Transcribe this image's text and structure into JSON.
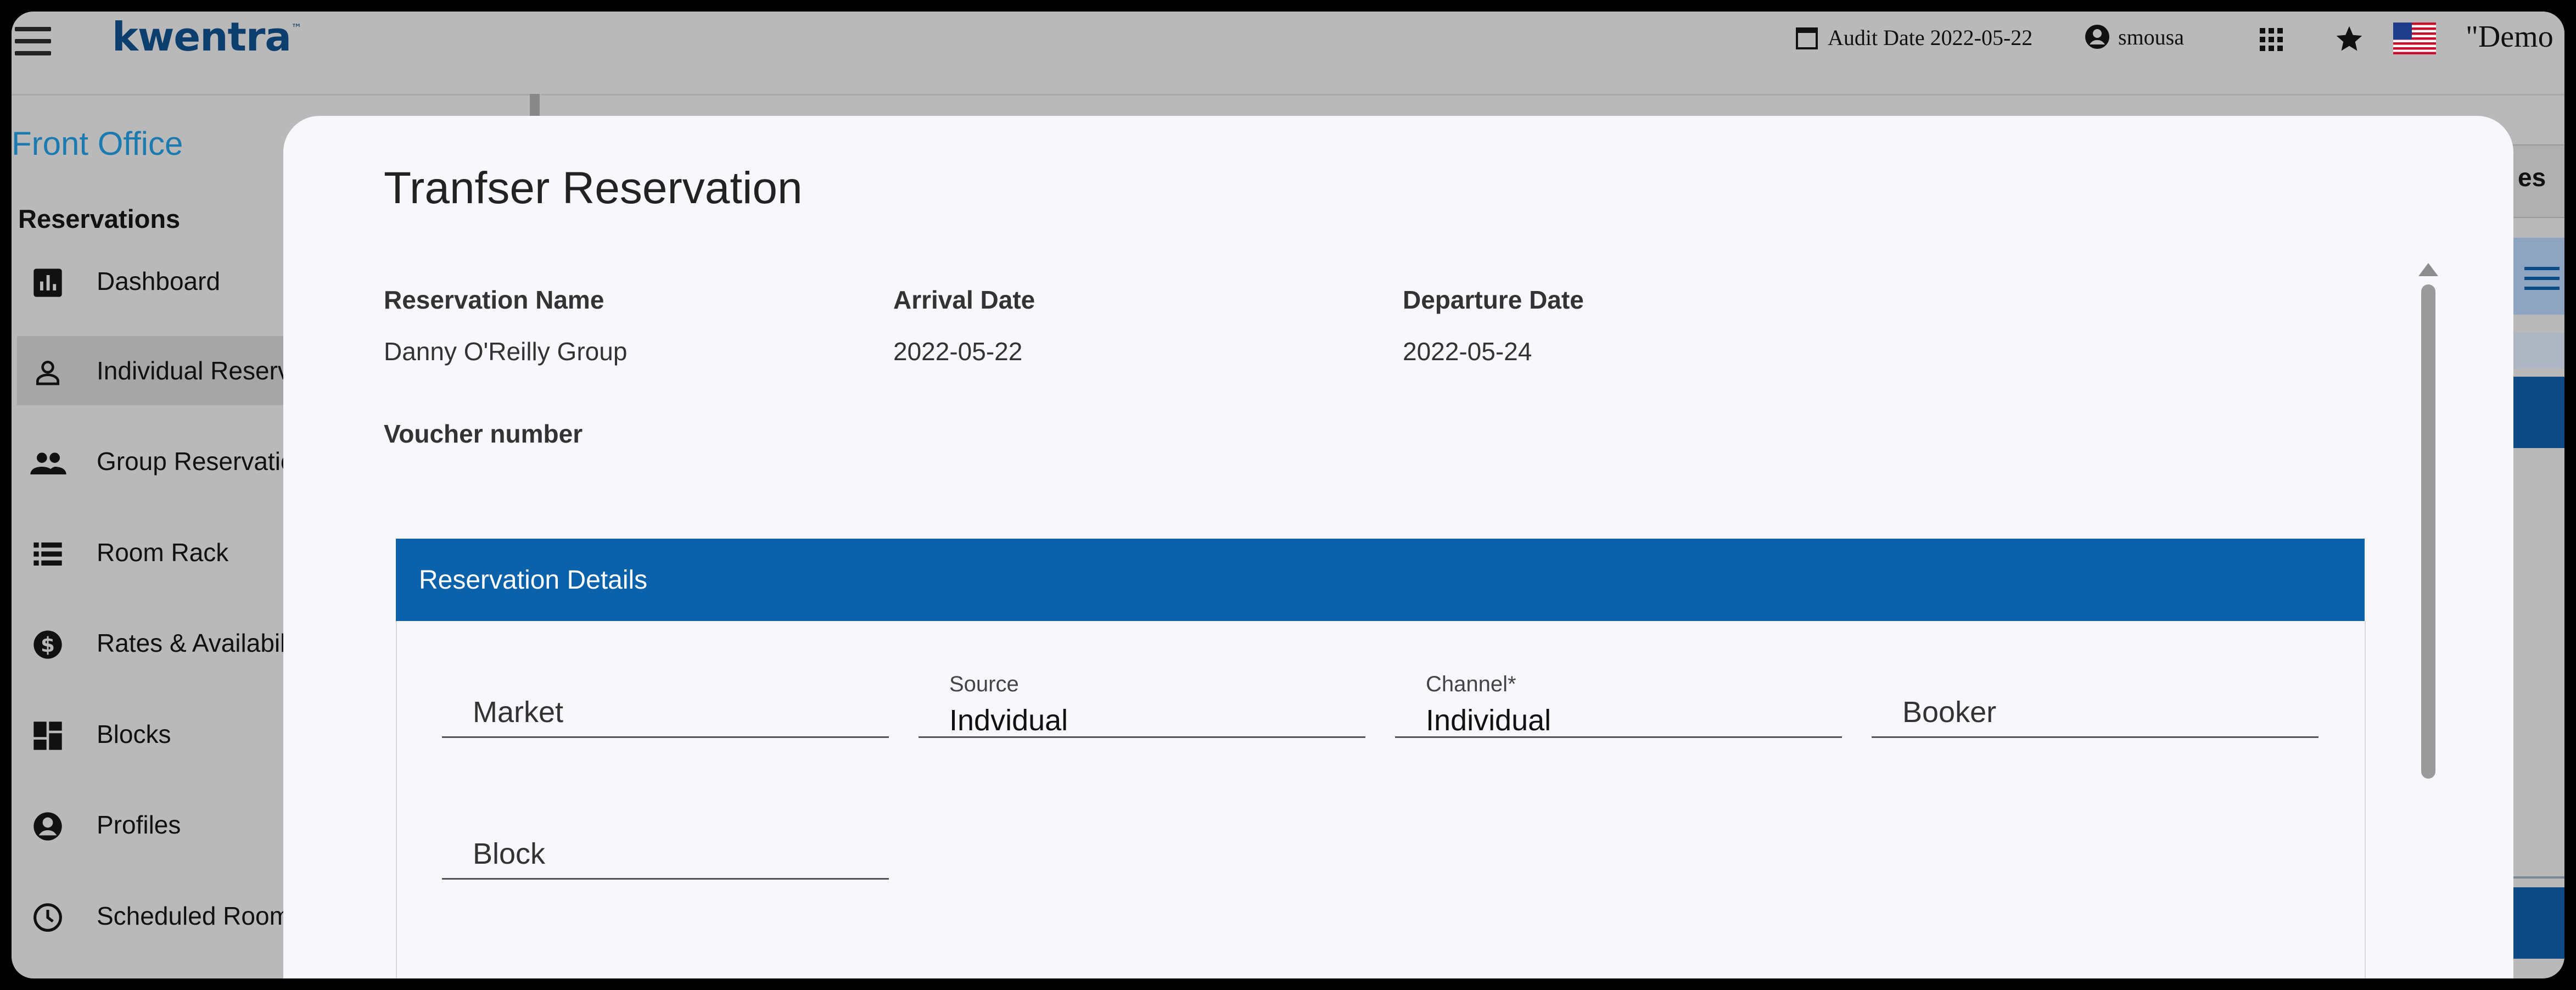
{
  "topbar": {
    "logo": "kwentra",
    "logo_tm": "™",
    "audit_date": "Audit Date 2022-05-22",
    "user": "smousa",
    "property": "\"Demo"
  },
  "sidebar": {
    "title": "Front Office",
    "section": "Reservations",
    "items": [
      {
        "label": "Dashboard",
        "icon": "bar-chart-icon"
      },
      {
        "label": "Individual Reserv",
        "icon": "person-icon"
      },
      {
        "label": "Group Reservatio",
        "icon": "group-icon"
      },
      {
        "label": "Room Rack",
        "icon": "list-icon"
      },
      {
        "label": "Rates & Availabil",
        "icon": "dollar-icon"
      },
      {
        "label": "Blocks",
        "icon": "dashboard-blocks-icon"
      },
      {
        "label": "Profiles",
        "icon": "account-circle-icon"
      },
      {
        "label": "Scheduled Room",
        "icon": "clock-icon"
      }
    ]
  },
  "background_partial": {
    "text": "es"
  },
  "modal": {
    "title": "Tranfser Reservation",
    "reservation_name_label": "Reservation Name",
    "reservation_name": "Danny O'Reilly Group",
    "arrival_label": "Arrival Date",
    "arrival": "2022-05-22",
    "departure_label": "Departure Date",
    "departure": "2022-05-24",
    "voucher_label": "Voucher number",
    "details_header": "Reservation Details",
    "fields": {
      "market": {
        "label": "Market"
      },
      "source": {
        "label": "Source",
        "value": "Indvidual"
      },
      "channel": {
        "label": "Channel*",
        "value": "Individual"
      },
      "booker": {
        "label": "Booker"
      },
      "block": {
        "label": "Block"
      }
    }
  },
  "colors": {
    "accent": "#0b62aa",
    "nav_title": "#1b7bb0",
    "logo": "#0c3f6e",
    "overlay": "#b9b9b9"
  }
}
